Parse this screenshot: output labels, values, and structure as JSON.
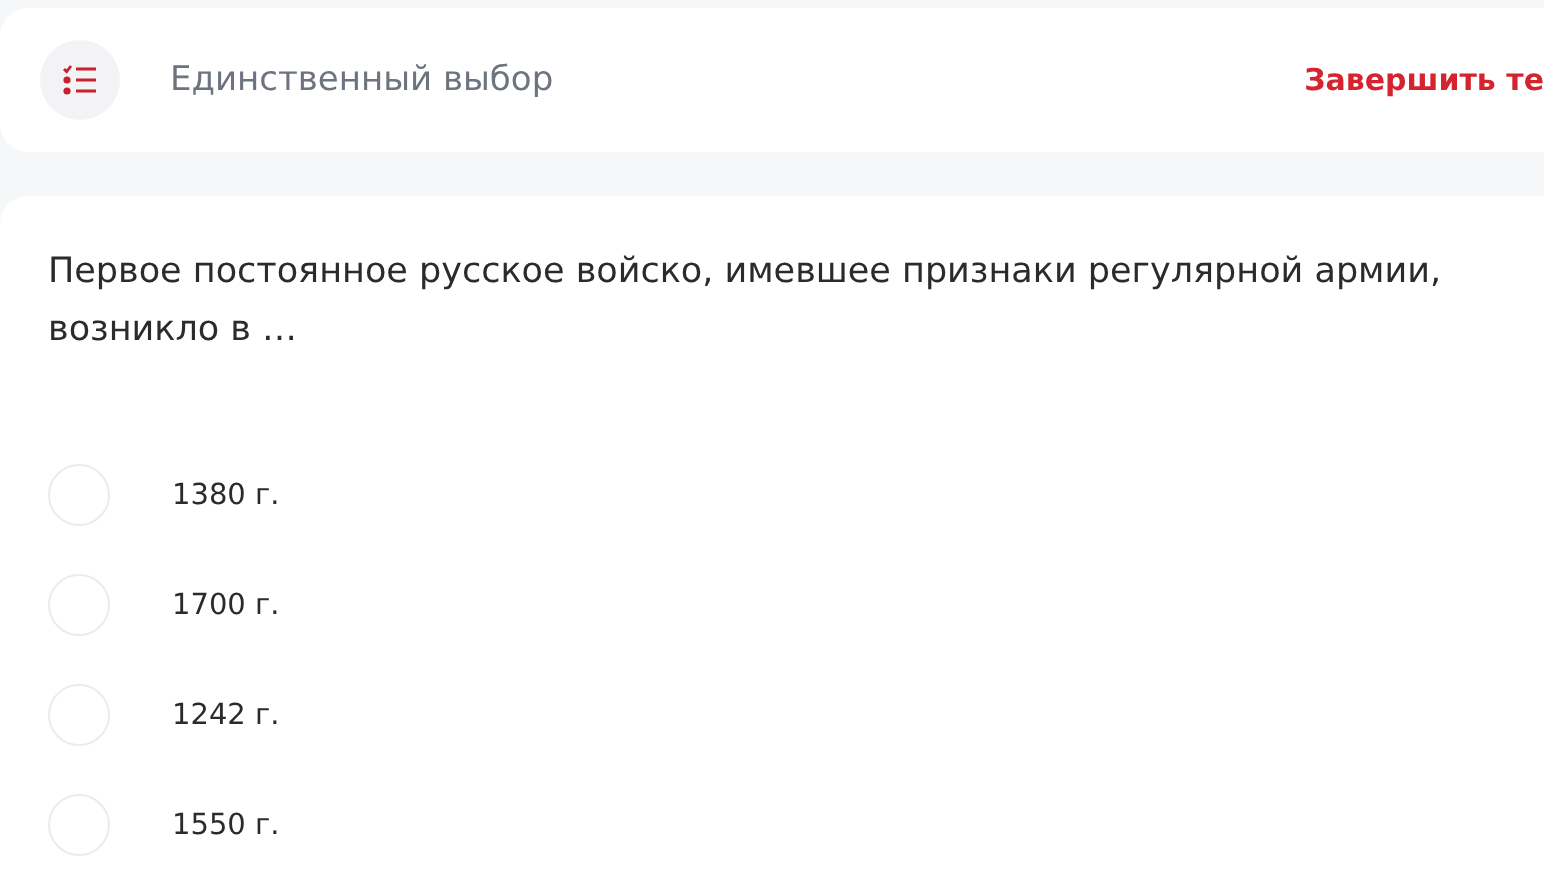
{
  "header": {
    "title": "Единственный выбор",
    "finish_link": "Завершить те"
  },
  "question": {
    "text": "Первое постоянное русское войско, имевшее признаки регулярной армии, возникло в …"
  },
  "options": [
    {
      "label": "1380 г.",
      "selected": false
    },
    {
      "label": "1700 г.",
      "selected": false
    },
    {
      "label": "1242 г.",
      "selected": false
    },
    {
      "label": "1550 г.",
      "selected": false
    }
  ]
}
